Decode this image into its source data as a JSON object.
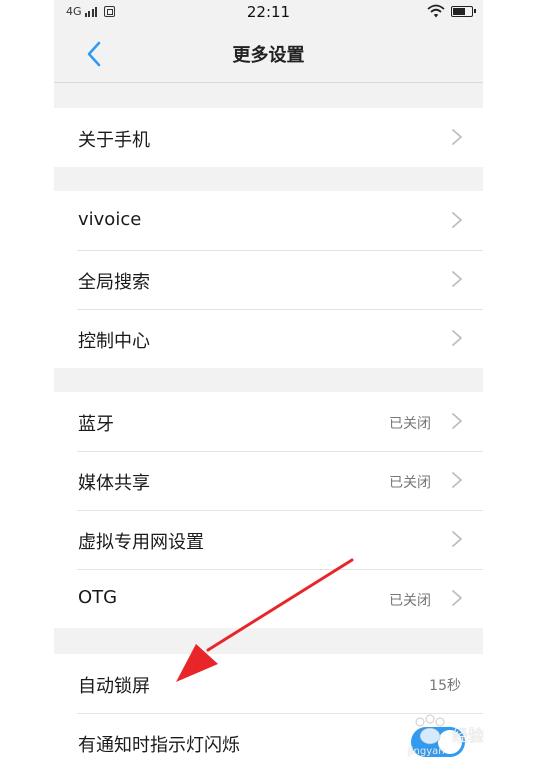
{
  "status_bar": {
    "network": "4G",
    "time": "22:11"
  },
  "header": {
    "title": "更多设置",
    "back_icon": "chevron-left-icon"
  },
  "groups": [
    {
      "items": [
        {
          "label": "关于手机",
          "value": ""
        }
      ]
    },
    {
      "items": [
        {
          "label": "vivoice",
          "value": ""
        },
        {
          "label": "全局搜索",
          "value": ""
        },
        {
          "label": "控制中心",
          "value": ""
        }
      ]
    },
    {
      "items": [
        {
          "label": "蓝牙",
          "value": "已关闭"
        },
        {
          "label": "媒体共享",
          "value": "已关闭"
        },
        {
          "label": "虚拟专用网设置",
          "value": ""
        },
        {
          "label": "OTG",
          "value": "已关闭"
        }
      ]
    },
    {
      "items": [
        {
          "label": "自动锁屏",
          "value": "15秒"
        },
        {
          "label": "有通知时指示灯闪烁",
          "toggle": true
        }
      ]
    }
  ],
  "watermark": {
    "text": "经验",
    "sub": "jingyan"
  },
  "colors": {
    "accent": "#2f9bf2",
    "annotation_arrow": "#e8262a",
    "background": "#f2f2f2"
  }
}
